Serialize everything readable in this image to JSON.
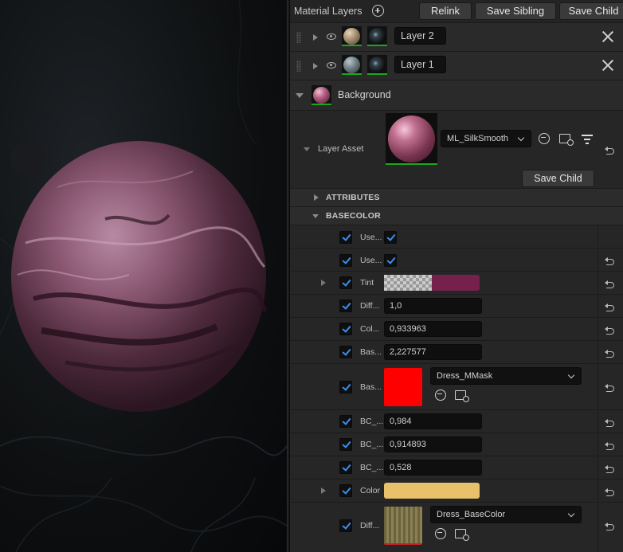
{
  "viewport": {
    "preview_label": ""
  },
  "toolbar": {
    "title": "Material Layers",
    "relink": "Relink",
    "save_sibling": "Save Sibling",
    "save_child": "Save Child"
  },
  "layers": [
    {
      "name": "Layer 2"
    },
    {
      "name": "Layer 1"
    }
  ],
  "background": {
    "label": "Background"
  },
  "layer_asset": {
    "label": "Layer Asset",
    "asset": "ML_SilkSmooth",
    "save_child": "Save Child"
  },
  "sections": {
    "attributes": "ATTRIBUTES",
    "basecolor": "BASECOLOR"
  },
  "params": {
    "use1": "Use...",
    "use2": "Use...",
    "tint": "Tint",
    "diff": "Diff...",
    "diff_value": "1,0",
    "col": "Col...",
    "col_value": "0,933963",
    "bas1": "Bas...",
    "bas1_value": "2,227577",
    "bas2": "Bas...",
    "bas2_texture": "Dress_MMask",
    "bc1": "BC_...",
    "bc1_value": "0,984",
    "bc2": "BC_...",
    "bc2_value": "0,914893",
    "bc3": "BC_...",
    "bc3_value": "0,528",
    "color": "Color",
    "diff2": "Diff...",
    "diff2_texture": "Dress_BaseColor"
  },
  "colors": {
    "tint": "#76204e",
    "bas2_swatch": "#ff0000",
    "color_swatch": "#e9c16a",
    "check_accent": "#3b8ff0",
    "active_green": "#1fa61f"
  }
}
